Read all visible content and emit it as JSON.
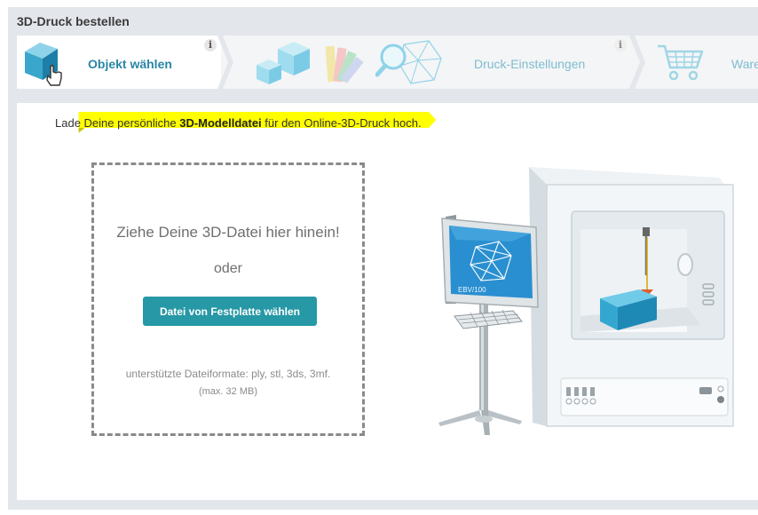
{
  "header": {
    "title": "3D-Druck bestellen"
  },
  "steps": [
    {
      "label": "Objekt wählen",
      "info": "i"
    },
    {
      "label": "Druck-Einstellungen",
      "info": "i"
    },
    {
      "label": "Ware"
    }
  ],
  "banner": {
    "text_before": "Lade Deine persönliche ",
    "text_bold": "3D-Modelldatei",
    "text_after": " für den Online-3D-Druck hoch."
  },
  "upload": {
    "title": "Ziehe Deine 3D-Datei hier hinein!",
    "or": "oder",
    "button": "Datei von Festplatte wählen",
    "formats": "unterstützte Dateiformate: ply, stl, 3ds, 3mf.",
    "max_size": "(max. 32 MB)"
  },
  "illustration": {
    "monitor_brand": "EBV/100"
  },
  "colors": {
    "accent": "#2798a6",
    "active_step_text": "#2a86a6",
    "inactive_step_text": "#7fbcd0",
    "banner": "#ffff00",
    "frame": "#e3e6ea"
  }
}
